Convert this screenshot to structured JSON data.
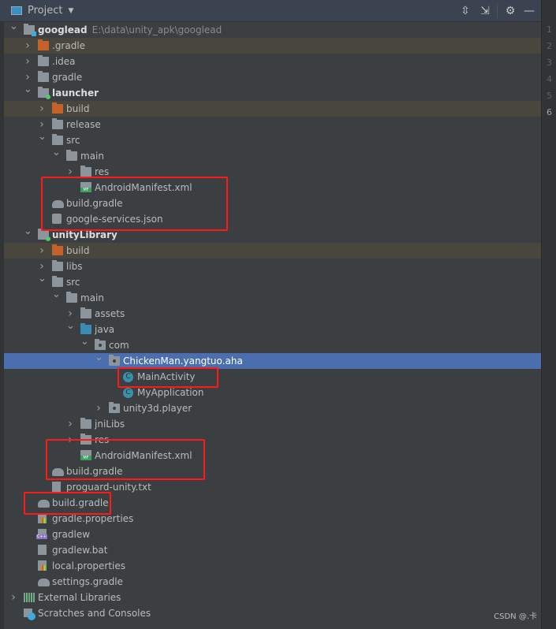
{
  "header": {
    "title": "Project",
    "icons": [
      "expand-all-icon",
      "collapse-all-icon",
      "gear-icon",
      "minimize-icon"
    ]
  },
  "gutter": {
    "line_numbers": [
      "1",
      "2",
      "3",
      "4",
      "5",
      "6"
    ],
    "current_line": "6"
  },
  "colors": {
    "selection": "#4b6eaf",
    "excluded_row": "#49463d",
    "highlight_box": "#ff1a1a",
    "background": "#3c3f41"
  },
  "tree": [
    {
      "label": "googlead",
      "path": "E:\\data\\unity_apk\\googlead",
      "level": 0,
      "chevron": "open",
      "icon": "root-folder",
      "bold": true
    },
    {
      "label": ".gradle",
      "level": 1,
      "chevron": "closed",
      "icon": "folder-orange",
      "excluded": true
    },
    {
      "label": ".idea",
      "level": 1,
      "chevron": "closed",
      "icon": "folder"
    },
    {
      "label": "gradle",
      "level": 1,
      "chevron": "closed",
      "icon": "folder"
    },
    {
      "label": "launcher",
      "level": 1,
      "chevron": "open",
      "icon": "module-folder",
      "bold": true
    },
    {
      "label": "build",
      "level": 2,
      "chevron": "closed",
      "icon": "folder-orange",
      "excluded": true
    },
    {
      "label": "release",
      "level": 2,
      "chevron": "closed",
      "icon": "folder"
    },
    {
      "label": "src",
      "level": 2,
      "chevron": "open",
      "icon": "folder"
    },
    {
      "label": "main",
      "level": 3,
      "chevron": "open",
      "icon": "folder"
    },
    {
      "label": "res",
      "level": 4,
      "chevron": "closed",
      "icon": "folder"
    },
    {
      "label": "AndroidManifest.xml",
      "level": 4,
      "icon": "manifest"
    },
    {
      "label": "build.gradle",
      "level": 2,
      "icon": "gradle"
    },
    {
      "label": "google-services.json",
      "level": 2,
      "icon": "json"
    },
    {
      "label": "unityLibrary",
      "level": 1,
      "chevron": "open",
      "icon": "module-folder",
      "bold": true
    },
    {
      "label": "build",
      "level": 2,
      "chevron": "closed",
      "icon": "folder-orange",
      "excluded": true
    },
    {
      "label": "libs",
      "level": 2,
      "chevron": "closed",
      "icon": "folder"
    },
    {
      "label": "src",
      "level": 2,
      "chevron": "open",
      "icon": "folder"
    },
    {
      "label": "main",
      "level": 3,
      "chevron": "open",
      "icon": "folder"
    },
    {
      "label": "assets",
      "level": 4,
      "chevron": "closed",
      "icon": "folder"
    },
    {
      "label": "java",
      "level": 4,
      "chevron": "open",
      "icon": "folder-blue"
    },
    {
      "label": "com",
      "level": 5,
      "chevron": "open",
      "icon": "package"
    },
    {
      "label": "ChickenMan.yangtuo.aha",
      "level": 6,
      "chevron": "open",
      "icon": "package",
      "selected": true
    },
    {
      "label": "MainActivity",
      "level": 7,
      "icon": "class"
    },
    {
      "label": "MyApplication",
      "level": 7,
      "icon": "class"
    },
    {
      "label": "unity3d.player",
      "level": 6,
      "chevron": "closed",
      "icon": "package"
    },
    {
      "label": "jniLibs",
      "level": 4,
      "chevron": "closed",
      "icon": "folder"
    },
    {
      "label": "res",
      "level": 4,
      "chevron": "closed",
      "icon": "folder"
    },
    {
      "label": "AndroidManifest.xml",
      "level": 4,
      "icon": "manifest"
    },
    {
      "label": "build.gradle",
      "level": 2,
      "icon": "gradle"
    },
    {
      "label": "proguard-unity.txt",
      "level": 2,
      "icon": "text-file"
    },
    {
      "label": "build.gradle",
      "level": 1,
      "icon": "gradle"
    },
    {
      "label": "gradle.properties",
      "level": 1,
      "icon": "properties"
    },
    {
      "label": "gradlew",
      "level": 1,
      "icon": "cpp-file"
    },
    {
      "label": "gradlew.bat",
      "level": 1,
      "icon": "text-file"
    },
    {
      "label": "local.properties",
      "level": 1,
      "icon": "properties"
    },
    {
      "label": "settings.gradle",
      "level": 1,
      "icon": "gradle"
    },
    {
      "label": "External Libraries",
      "level": 0,
      "chevron": "closed",
      "icon": "libraries"
    },
    {
      "label": "Scratches and Consoles",
      "level": 0,
      "icon": "scratches"
    }
  ],
  "watermark": "CSDN @.卡"
}
